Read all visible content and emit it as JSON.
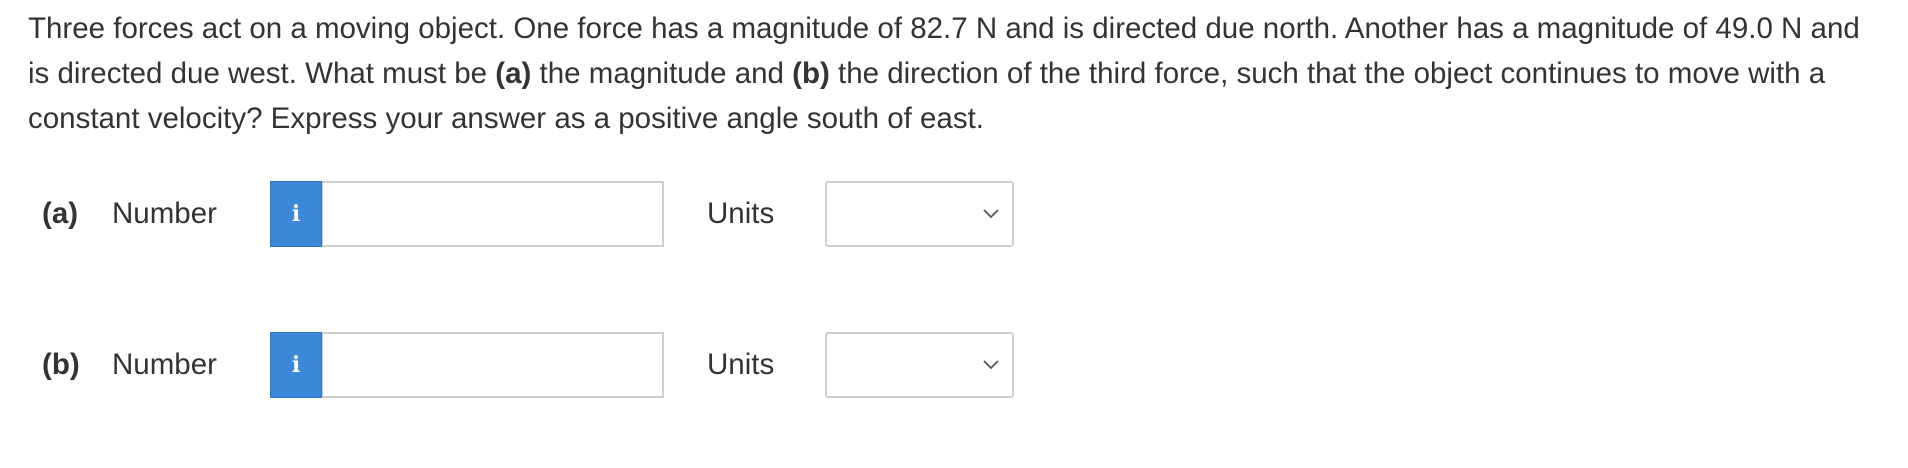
{
  "question": {
    "part1": "Three forces act on a moving object. One force has a magnitude of 82.7 N and is directed due north. Another has a magnitude of 49.0 N and is directed due west. What must be ",
    "a_marker": "(a)",
    "part2": " the magnitude and ",
    "b_marker": "(b)",
    "part3": " the direction of the third force, such that the object continues to move with a constant velocity? Express your answer as a positive angle south of east."
  },
  "answers": [
    {
      "part_label": "(a)",
      "number_label": "Number",
      "info_icon": "i",
      "number_value": "",
      "units_label": "Units",
      "units_selected": ""
    },
    {
      "part_label": "(b)",
      "number_label": "Number",
      "info_icon": "i",
      "number_value": "",
      "units_label": "Units",
      "units_selected": ""
    }
  ],
  "colors": {
    "info_button": "#3b88d8",
    "text": "#333333",
    "border": "#cfcfcf"
  }
}
